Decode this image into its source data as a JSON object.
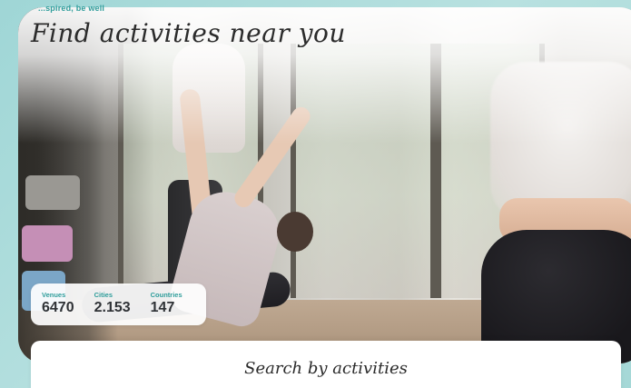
{
  "hero": {
    "tagline": "...spired, be well",
    "headline": "Find activities near you"
  },
  "stats": [
    {
      "label": "Venues",
      "value": "6470"
    },
    {
      "label": "Cities",
      "value": "2.153"
    },
    {
      "label": "Countries",
      "value": "147"
    }
  ],
  "search": {
    "title": "Search by activities"
  },
  "colors": {
    "accent": "#2f9d9b",
    "background": "#a8d9d8",
    "text": "#2b2b2b"
  }
}
